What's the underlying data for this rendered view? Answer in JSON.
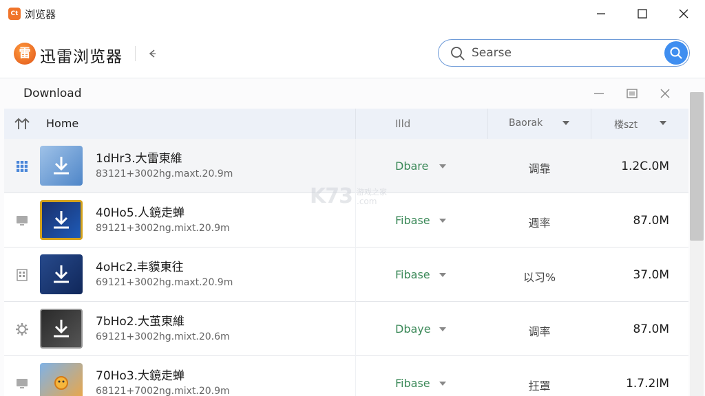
{
  "window": {
    "logo_text": "Ct",
    "title": "浏览器"
  },
  "header": {
    "brand_logo_text": "雷",
    "brand_name": "迅雷浏览器",
    "back_icon": "back-arrow-icon"
  },
  "search": {
    "placeholder": "Searse",
    "value": ""
  },
  "panel": {
    "title": "Download",
    "columns": {
      "name": "Home",
      "status": "Illd",
      "rate": "Baorak",
      "size": "楼szt"
    }
  },
  "rows": [
    {
      "icon": "grid-icon",
      "name": "1dHr3.大雷東維",
      "meta": "83121+3002hg.maxt.20.9m",
      "status": "Dbare",
      "rate": "调靠",
      "size": "1.2C.0M"
    },
    {
      "icon": "monitor-icon",
      "name": "40Ho5.人鏡走蝉",
      "meta": "89121+3002ng.mixt.20.9m",
      "status": "Fibase",
      "rate": "週率",
      "size": "87.0M"
    },
    {
      "icon": "building-icon",
      "name": "4oHc2.丰貘東往",
      "meta": "69121+3002hg.maxt.20.9m",
      "status": "Fibase",
      "rate": "以习%",
      "size": "37.0M"
    },
    {
      "icon": "gear-icon",
      "name": "7bHo2.大茧東維",
      "meta": "69121+3002hg.mixt.20.6m",
      "status": "Dbaye",
      "rate": "调率",
      "size": "87.0M"
    },
    {
      "icon": "monitor-icon",
      "name": "70Ho3.大鏡走蝉",
      "meta": "68121+7002ng.mixt.20.9m",
      "status": "Fibase",
      "rate": "抂罩",
      "size": "1.7.2IM"
    }
  ],
  "watermark": {
    "brand": "K73",
    "sub": "游戏之家",
    "domain": ".com"
  },
  "colors": {
    "accent": "#3f8ef0",
    "status_green": "#3d8a5a",
    "brand_orange": "#f0742a"
  }
}
